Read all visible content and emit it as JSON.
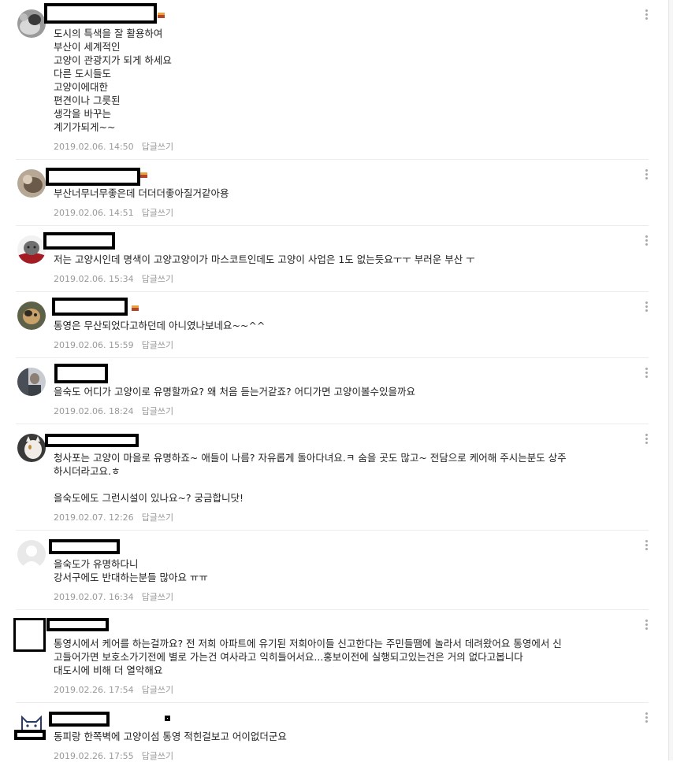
{
  "comments": [
    {
      "text": "도시의 특색을 잘 활용하여\n부산이 세계적인\n고양이 관광지가 되게 하세요\n다른 도시들도\n고양이에대한\n편견이나 그릇된\n생각을 바꾸는\n계기가되게~~",
      "date": "2019.02.06. 14:50",
      "reply_label": "답글쓰기",
      "avatar": "cat-photo-avatar"
    },
    {
      "text": "부산너무너무좋은데 더더더좋아질거같아용",
      "date": "2019.02.06. 14:51",
      "reply_label": "답글쓰기",
      "avatar": "cat-photo-avatar"
    },
    {
      "text": "저는 고양시인데 명색이 고양고양이가 마스코트인데도 고양이 사업은 1도 없는듯요ㅜㅜ 부러운 부산 ㅜ",
      "date": "2019.02.06. 15:34",
      "reply_label": "답글쓰기",
      "avatar": "cat-photo-avatar"
    },
    {
      "text": "통영은 무산되었다고하던데 아니였나보네요~~^^",
      "date": "2019.02.06. 15:59",
      "reply_label": "답글쓰기",
      "avatar": "cat-photo-avatar"
    },
    {
      "text": "을숙도 어디가 고양이로 유명할까요? 왜 처음 듣는거같죠? 어디가면 고양이볼수있을까요",
      "date": "2019.02.06. 18:24",
      "reply_label": "답글쓰기",
      "avatar": "person-photo-avatar"
    },
    {
      "text": "청사포는 고양이 마을로 유명하죠~ 애들이 나름? 자유롭게 돌아다녀요.ㅋ 숨을 곳도 많고~ 전담으로 케어해 주시는분도 상주\n하시더라고요.ㅎ\n\n을숙도에도 그런시설이 있나요~? 궁금합니닷!",
      "date": "2019.02.07. 12:26",
      "reply_label": "답글쓰기",
      "avatar": "cat-photo-avatar"
    },
    {
      "text": "을숙도가 유명하다니\n강서구에도 반대하는분들 많아요 ㅠㅠ",
      "date": "2019.02.07. 16:34",
      "reply_label": "답글쓰기",
      "avatar": "default-user-avatar"
    },
    {
      "text": "통영시에서 케어를 하는걸까요? 전 저희 아파트에 유기된 저희아이들 신고한다는 주민들땜에 놀라서 데려왔어요 통영에서 신\n고들어가면 보호소가기전에 별로 가는건 여사라고 익히들어서요...홍보이전에 실행되고있는건은 거의 없다고봅니다\n대도시에 비해 더 열악해요",
      "date": "2019.02.26. 17:54",
      "reply_label": "답글쓰기",
      "avatar": "redacted-avatar"
    },
    {
      "text": "동피랑 한쪽벽에 고양이섬 통영 적힌걸보고 어이없더군요",
      "date": "2019.02.26. 17:55",
      "reply_label": "답글쓰기",
      "avatar": "cat-cartoon-avatar"
    }
  ],
  "colors": {
    "meta_text": "#999999",
    "body_text": "#222222",
    "divider": "#ececec",
    "redaction": "#000000",
    "badge_top": "#e8a33c",
    "badge_bottom": "#b4452c"
  }
}
